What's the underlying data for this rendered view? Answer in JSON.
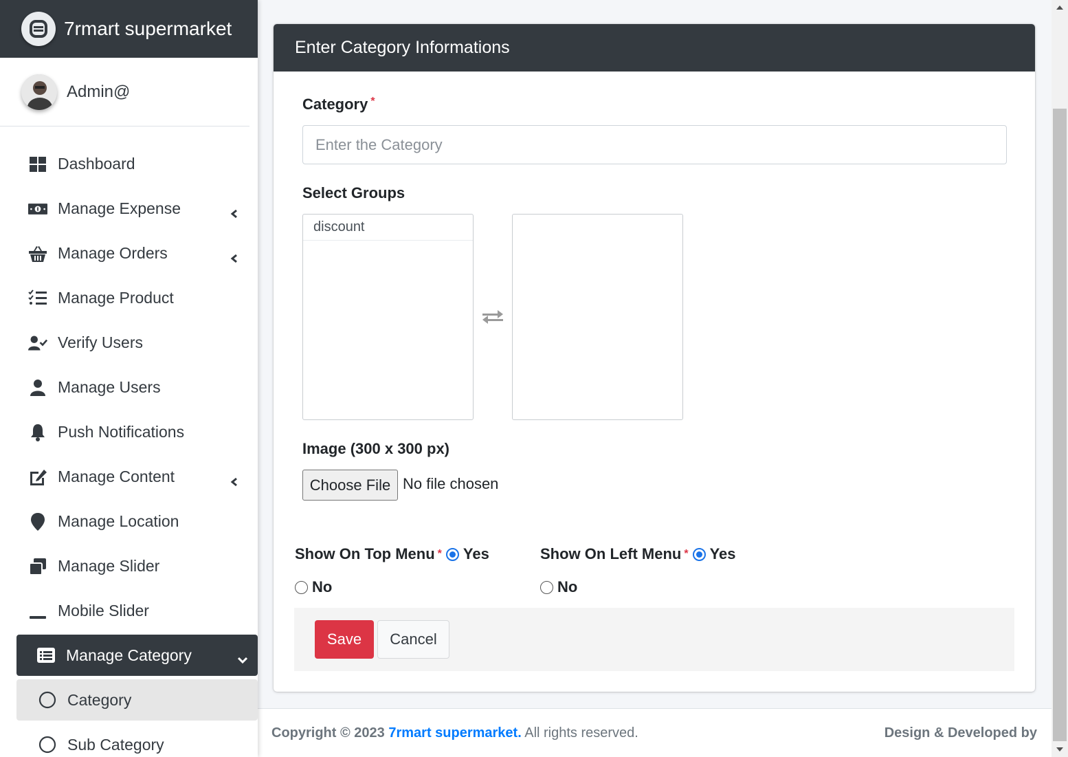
{
  "brand": {
    "name": "7rmart supermarket",
    "logo_icon": "brand-logo-icon"
  },
  "user": {
    "name": "Admin@"
  },
  "sidebar": {
    "items": [
      {
        "label": "Dashboard",
        "icon": "dashboard-icon",
        "has_arrow": false
      },
      {
        "label": "Manage Expense",
        "icon": "money-bill-icon",
        "has_arrow": true
      },
      {
        "label": "Manage Orders",
        "icon": "basket-icon",
        "has_arrow": true
      },
      {
        "label": "Manage Product",
        "icon": "tasks-list-icon",
        "has_arrow": false
      },
      {
        "label": "Verify Users",
        "icon": "user-check-icon",
        "has_arrow": false
      },
      {
        "label": "Manage Users",
        "icon": "user-icon",
        "has_arrow": false
      },
      {
        "label": "Push Notifications",
        "icon": "bell-icon",
        "has_arrow": false
      },
      {
        "label": "Manage Content",
        "icon": "edit-icon",
        "has_arrow": true
      },
      {
        "label": "Manage Location",
        "icon": "map-marker-icon",
        "has_arrow": false
      },
      {
        "label": "Manage Slider",
        "icon": "window-restore-icon",
        "has_arrow": false
      },
      {
        "label": "Mobile Slider",
        "icon": "minus-icon",
        "has_arrow": false
      },
      {
        "label": "Manage Category",
        "icon": "list-alt-icon",
        "has_arrow": true,
        "active": true
      },
      {
        "label": "Category",
        "icon": "circle-icon",
        "sub": true,
        "selected": true
      },
      {
        "label": "Sub Category",
        "icon": "circle-icon",
        "sub": true
      }
    ]
  },
  "form": {
    "header": "Enter Category Informations",
    "category_label": "Category",
    "required_mark": "*",
    "category_placeholder": "Enter the Category",
    "category_value": "",
    "groups_label": "Select Groups",
    "available_groups": [
      "discount"
    ],
    "selected_groups": [],
    "image_label": "Image (300 x 300 px)",
    "file_button": "Choose File",
    "file_status": "No file chosen",
    "top_menu_label": "Show On Top Menu",
    "left_menu_label": "Show On Left Menu",
    "yes_label": "Yes",
    "no_label": "No",
    "top_menu_value": "Yes",
    "left_menu_value": "Yes",
    "save_label": "Save",
    "cancel_label": "Cancel"
  },
  "footer": {
    "copyright_prefix": "Copyright © 2023",
    "company_link": "7rmart supermarket.",
    "rights": "All rights reserved.",
    "right_text": "Design & Developed by"
  },
  "colors": {
    "sidebar_dark": "#343a40",
    "save_button": "#dc3545",
    "link": "#007bff",
    "radio_checked": "#1a73e8"
  }
}
